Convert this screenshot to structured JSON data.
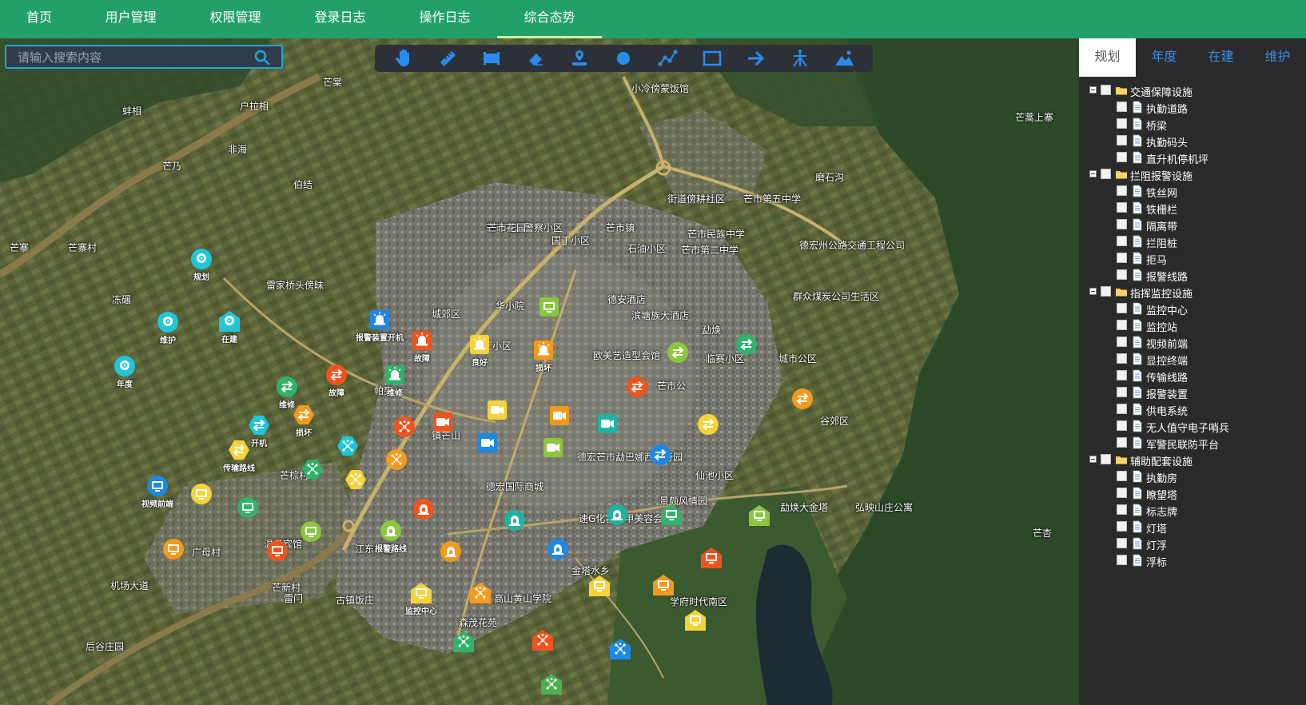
{
  "nav": {
    "items": [
      {
        "label": "首页"
      },
      {
        "label": "用户管理"
      },
      {
        "label": "权限管理"
      },
      {
        "label": "登录日志"
      },
      {
        "label": "操作日志"
      },
      {
        "label": "综合态势",
        "active": true
      }
    ]
  },
  "search": {
    "placeholder": "请输入搜索内容",
    "value": "",
    "icon": "search-icon"
  },
  "toolbar": {
    "tools": [
      {
        "icon": "pan-hand-icon"
      },
      {
        "icon": "measure-ruler-icon"
      },
      {
        "icon": "measure-area-icon"
      },
      {
        "icon": "eraser-icon"
      },
      {
        "icon": "place-marker-icon"
      },
      {
        "icon": "draw-point-icon"
      },
      {
        "icon": "draw-polyline-icon"
      },
      {
        "icon": "draw-rectangle-icon"
      },
      {
        "icon": "draw-arrow-icon"
      },
      {
        "icon": "draw-tower-icon"
      },
      {
        "icon": "draw-mountain-icon"
      }
    ]
  },
  "panel": {
    "tabs": [
      {
        "label": "规划",
        "active": true
      },
      {
        "label": "年度"
      },
      {
        "label": "在建"
      },
      {
        "label": "维护"
      }
    ],
    "tree": [
      {
        "label": "交通保障设施",
        "children": [
          "执勤道路",
          "桥梁",
          "执勤码头",
          "直升机停机坪"
        ]
      },
      {
        "label": "拦阻报警设施",
        "children": [
          "铁丝网",
          "铁栅栏",
          "隔离带",
          "拦阻桩",
          "拒马",
          "报警线路"
        ]
      },
      {
        "label": "指挥监控设施",
        "children": [
          "监控中心",
          "监控站",
          "视频前端",
          "显控终端",
          "传输线路",
          "报警装置",
          "供电系统",
          "无人值守电子哨兵",
          "军警民联防平台"
        ]
      },
      {
        "label": "辅助配套设施",
        "children": [
          "执勤房",
          "瞭望塔",
          "标志牌",
          "灯塔",
          "灯浮",
          "浮标"
        ]
      }
    ]
  },
  "map": {
    "colors": {
      "orange": "#f39a1e",
      "red": "#f0541e",
      "green": "#2fb36a",
      "lime": "#8cc63e",
      "blue": "#1e88e5",
      "cyan": "#1fc6d9",
      "yellow": "#f5d33a",
      "teal": "#20b2a0",
      "brightgreen": "#4caf50"
    },
    "markers": [
      {
        "label": "规划",
        "shape": "circle",
        "color": "cyan",
        "icon": "camera-icon"
      },
      {
        "label": "维护",
        "shape": "circle",
        "color": "cyan",
        "icon": "camera-icon"
      },
      {
        "label": "在建",
        "shape": "house",
        "color": "cyan",
        "icon": "camera-icon"
      },
      {
        "label": "年度",
        "shape": "circle",
        "color": "cyan",
        "icon": "camera-icon"
      },
      {
        "label": "报警装置开机",
        "shape": "square",
        "color": "blue",
        "icon": "alarm-icon"
      },
      {
        "label": "故障",
        "shape": "square",
        "color": "red",
        "icon": "alarm-icon"
      },
      {
        "label": "良好",
        "shape": "square",
        "color": "yellow",
        "icon": "alarm-icon"
      },
      {
        "label": "损坏",
        "shape": "square",
        "color": "orange",
        "icon": "alarm-icon"
      },
      {
        "label": "维修",
        "shape": "square",
        "color": "green",
        "icon": "alarm-icon"
      },
      {
        "label": "维修",
        "shape": "circle",
        "color": "green",
        "icon": "transfer-icon"
      },
      {
        "label": "故障",
        "shape": "circle",
        "color": "red",
        "icon": "transfer-icon"
      },
      {
        "label": "损坏",
        "shape": "hexagon",
        "color": "orange",
        "icon": "transfer-icon"
      },
      {
        "label": "开机",
        "shape": "hexagon",
        "color": "cyan",
        "icon": "transfer-icon"
      },
      {
        "label": "传输路线",
        "shape": "hexagon",
        "color": "yellow",
        "icon": "transfer-icon"
      },
      {
        "label": "视频前端",
        "shape": "circle",
        "color": "blue",
        "icon": "monitor-icon"
      },
      {
        "label": "报警路线",
        "shape": "circle",
        "color": "lime",
        "icon": "alarm-line-icon"
      },
      {
        "label": "监控中心",
        "shape": "house",
        "color": "yellow",
        "icon": "monitor-icon"
      },
      {
        "label": "",
        "shape": "square",
        "color": "lime",
        "icon": "monitor-icon"
      },
      {
        "label": "",
        "shape": "circle",
        "color": "lime",
        "icon": "transfer-icon"
      },
      {
        "label": "",
        "shape": "circle",
        "color": "green",
        "icon": "transfer-icon"
      },
      {
        "label": "",
        "shape": "circle",
        "color": "orange",
        "icon": "transfer-icon"
      },
      {
        "label": "",
        "shape": "circle",
        "color": "yellow",
        "icon": "transfer-icon"
      },
      {
        "label": "",
        "shape": "circle",
        "color": "blue",
        "icon": "transfer-icon"
      },
      {
        "label": "",
        "shape": "circle",
        "color": "red",
        "icon": "transfer-icon"
      },
      {
        "label": "",
        "shape": "circle",
        "color": "yellow",
        "icon": "monitor-icon"
      },
      {
        "label": "",
        "shape": "circle",
        "color": "green",
        "icon": "monitor-icon"
      },
      {
        "label": "",
        "shape": "circle",
        "color": "orange",
        "icon": "monitor-icon"
      },
      {
        "label": "",
        "shape": "circle",
        "color": "red",
        "icon": "monitor-icon"
      },
      {
        "label": "",
        "shape": "circle",
        "color": "lime",
        "icon": "monitor-icon"
      },
      {
        "label": "",
        "shape": "square",
        "color": "red",
        "icon": "video-icon"
      },
      {
        "label": "",
        "shape": "square",
        "color": "yellow",
        "icon": "video-icon"
      },
      {
        "label": "",
        "shape": "square",
        "color": "orange",
        "icon": "video-icon"
      },
      {
        "label": "",
        "shape": "square",
        "color": "blue",
        "icon": "video-icon"
      },
      {
        "label": "",
        "shape": "square",
        "color": "lime",
        "icon": "video-icon"
      },
      {
        "label": "",
        "shape": "square",
        "color": "teal",
        "icon": "video-icon"
      },
      {
        "label": "",
        "shape": "circle",
        "color": "red",
        "icon": "network-icon"
      },
      {
        "label": "",
        "shape": "circle",
        "color": "orange",
        "icon": "network-icon"
      },
      {
        "label": "",
        "shape": "hexagon",
        "color": "cyan",
        "icon": "network-icon"
      },
      {
        "label": "",
        "shape": "hexagon",
        "color": "green",
        "icon": "network-icon"
      },
      {
        "label": "",
        "shape": "hexagon",
        "color": "yellow",
        "icon": "network-icon"
      },
      {
        "label": "",
        "shape": "circle",
        "color": "red",
        "icon": "alarm-line-icon"
      },
      {
        "label": "",
        "shape": "circle",
        "color": "teal",
        "icon": "alarm-line-icon"
      },
      {
        "label": "",
        "shape": "circle",
        "color": "teal",
        "icon": "alarm-line-icon"
      },
      {
        "label": "",
        "shape": "circle",
        "color": "blue",
        "icon": "alarm-line-icon"
      },
      {
        "label": "",
        "shape": "circle",
        "color": "orange",
        "icon": "alarm-line-icon"
      },
      {
        "label": "",
        "shape": "house",
        "color": "green",
        "icon": "network-icon"
      },
      {
        "label": "",
        "shape": "house",
        "color": "orange",
        "icon": "network-icon"
      },
      {
        "label": "",
        "shape": "house",
        "color": "red",
        "icon": "network-icon"
      },
      {
        "label": "",
        "shape": "house",
        "color": "blue",
        "icon": "network-icon"
      },
      {
        "label": "",
        "shape": "house",
        "color": "brightgreen",
        "icon": "network-icon"
      },
      {
        "label": "",
        "shape": "house",
        "color": "yellow",
        "icon": "monitor-icon"
      },
      {
        "label": "",
        "shape": "house",
        "color": "orange",
        "icon": "monitor-icon"
      },
      {
        "label": "",
        "shape": "house",
        "color": "yellow",
        "icon": "monitor-icon"
      },
      {
        "label": "",
        "shape": "house",
        "color": "red",
        "icon": "monitor-icon"
      },
      {
        "label": "",
        "shape": "house",
        "color": "lime",
        "icon": "monitor-icon"
      },
      {
        "label": "",
        "shape": "house",
        "color": "green",
        "icon": "monitor-icon"
      }
    ],
    "place_labels": [
      "芒棠",
      "蚌相",
      "户拉相",
      "非海",
      "芒乃",
      "伯结",
      "芒寨",
      "芒寨村",
      "雷家桥头傍昧",
      "冻碾",
      "小冷傍蒙饭馆",
      "芒市花园警察小区",
      "国丁小区",
      "芒市镇",
      "石油小区",
      "芒市民族中学",
      "街道傍耕社区",
      "芒市第五中学",
      "磨石沟",
      "德宏州公路交通工程公司",
      "芒市花园",
      "华小院",
      "德安酒店",
      "滨塘族大酒店",
      "临赛小区",
      "东汇小区",
      "欧美艺造型会馆",
      "芒市公",
      "群众煤炭公司生活区",
      "芒棕村",
      "雷门",
      "芒新村",
      "后谷庄园",
      "帕亮",
      "镇芒山",
      "德宏芒市勐巴娜西珍奇园",
      "德宏国际商城",
      "速G化妆品甲美容会馆",
      "仙池小区",
      "景颇风情园",
      "勐焕大金塔",
      "弘映山庄公寓",
      "广母村",
      "温泉宾馆",
      "江东小区",
      "古镇饭庄",
      "高山黄山学院",
      "金塔水乡",
      "学府时代南区",
      "森茂花苑",
      "机场大道",
      "芒蒿上寨",
      "勐焕",
      "芒杏",
      "芒市第二中学",
      "城郊区",
      "城市公区",
      "谷郊区"
    ]
  }
}
